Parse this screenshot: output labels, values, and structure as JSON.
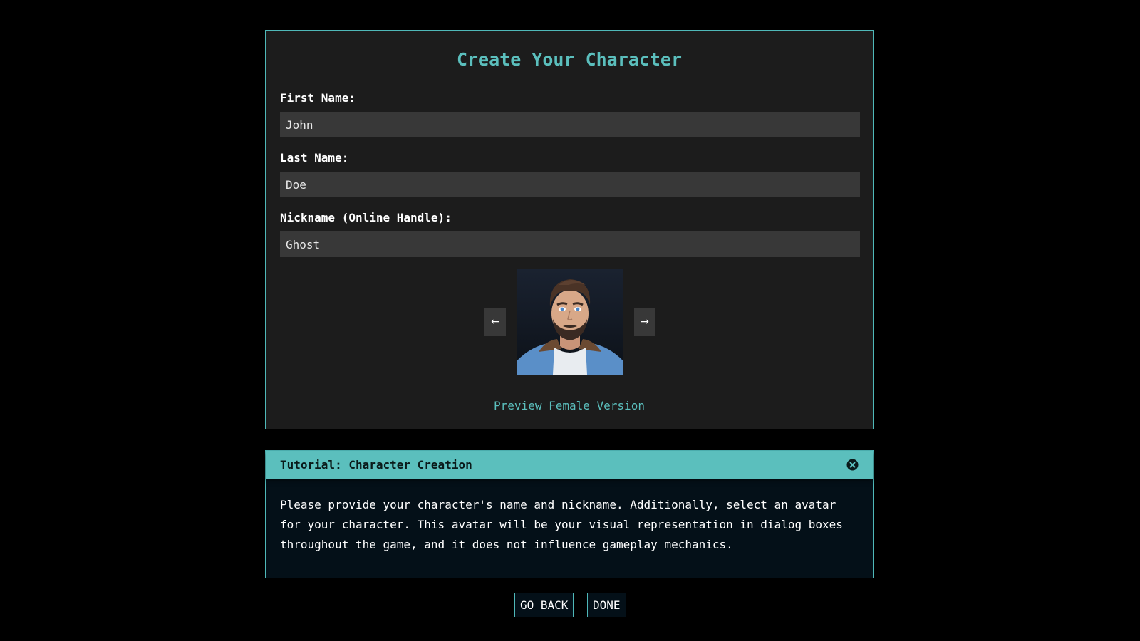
{
  "form": {
    "title": "Create Your Character",
    "first_name": {
      "label": "First Name:",
      "value": "John"
    },
    "last_name": {
      "label": "Last Name:",
      "value": "Doe"
    },
    "nickname": {
      "label": "Nickname (Online Handle):",
      "value": "Ghost"
    },
    "avatar": {
      "prev_label": "←",
      "next_label": "→",
      "preview_link": "Preview Female Version"
    }
  },
  "tutorial": {
    "title": "Tutorial: Character Creation",
    "body": "Please provide your character's name and nickname. Additionally, select an avatar for your character. This avatar will be your visual representation in dialog boxes throughout the game, and it does not influence gameplay mechanics."
  },
  "actions": {
    "go_back_label": "GO BACK",
    "done_label": "DONE"
  },
  "colors": {
    "accent": "#5bbfbd",
    "panel_bg": "#1c1c1c",
    "field_bg": "#383838",
    "page_bg": "#000000"
  }
}
